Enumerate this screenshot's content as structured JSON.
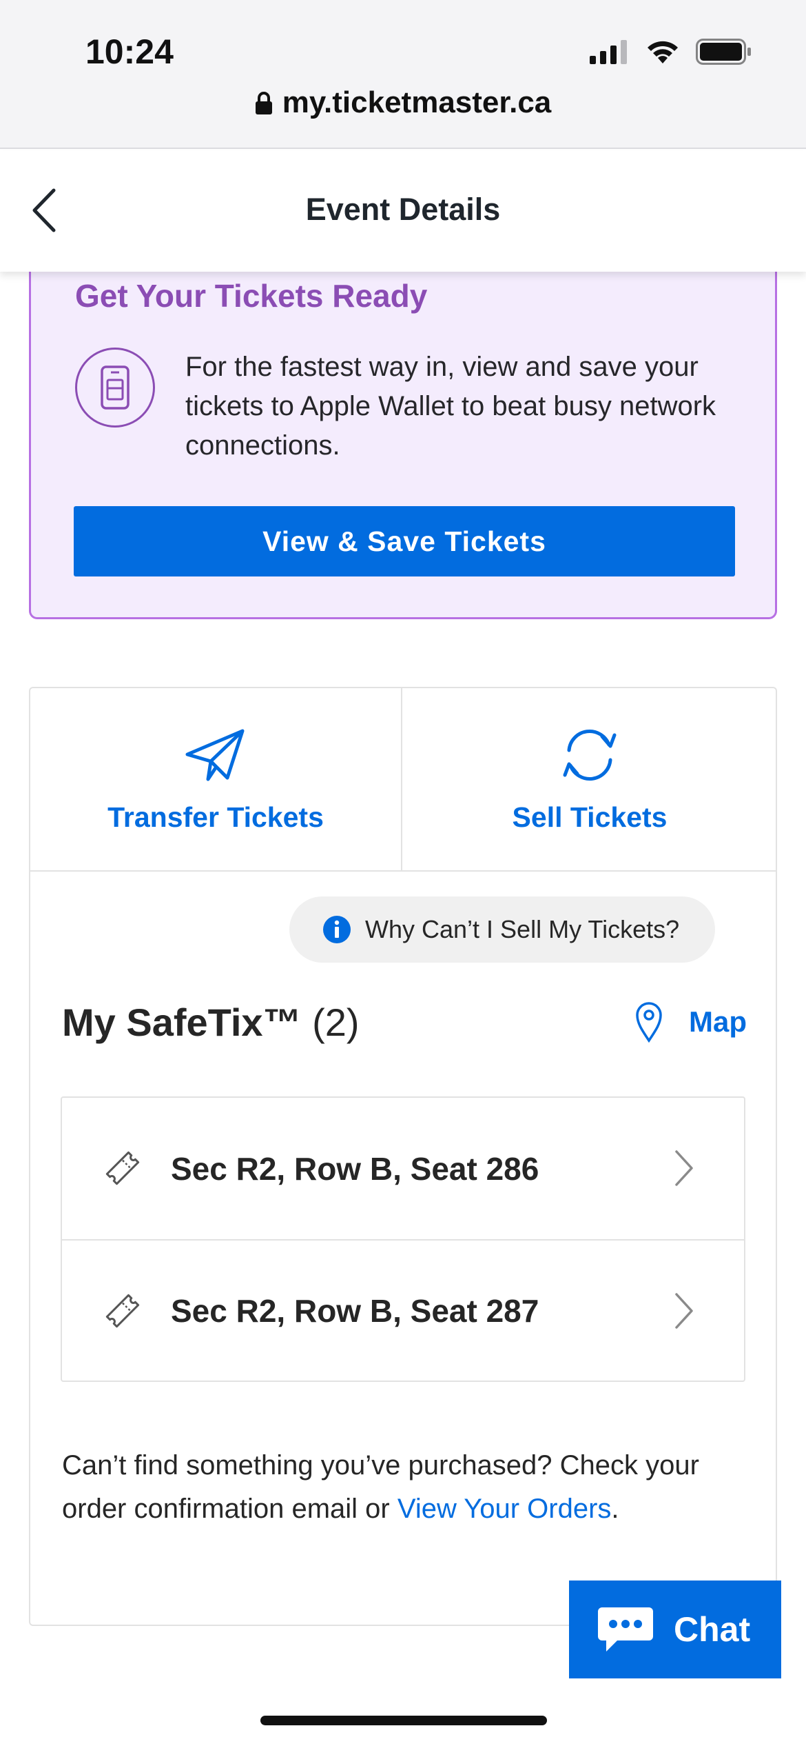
{
  "status_bar": {
    "time": "10:24"
  },
  "browser": {
    "url": "my.ticketmaster.ca"
  },
  "header": {
    "title": "Event Details"
  },
  "promo": {
    "title": "Get Your Tickets Ready",
    "text": "For the fastest way in, view and save your tickets to Apple Wallet to beat busy network connections.",
    "button_label": "View & Save Tickets"
  },
  "actions": {
    "transfer_label": "Transfer Tickets",
    "sell_label": "Sell Tickets"
  },
  "why_sell": {
    "label": "Why Can’t I Sell My Tickets?"
  },
  "safetix": {
    "title": "My SafeTix™",
    "count": "(2)",
    "map_label": "Map",
    "seats": [
      {
        "label": "Sec R2, Row B, Seat 286"
      },
      {
        "label": "Sec R2, Row B, Seat 287"
      }
    ]
  },
  "help": {
    "text": "Can’t find something you’ve purchased? Check your order confirmation email or ",
    "link": "View Your Orders",
    "end": "."
  },
  "chat": {
    "label": "Chat"
  },
  "colors": {
    "brand_blue": "#026cdf",
    "promo_purple": "#8b4db4",
    "promo_bg": "#f4ecfd"
  }
}
